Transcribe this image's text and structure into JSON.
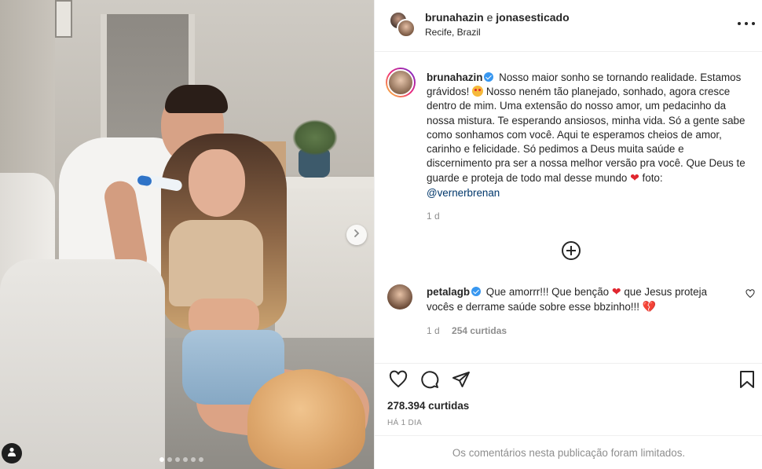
{
  "header": {
    "user1": "brunahazin",
    "conjunction": "e",
    "user2": "jonasesticado",
    "location": "Recife, Brazil"
  },
  "caption": {
    "username": "brunahazin",
    "text_part1": "Nosso maior sonho se tornando realidade. Estamos grávidos!",
    "text_part2": "Nosso neném tão planejado, sonhado, agora cresce dentro de mim. Uma extensão do nosso amor, um pedacinho da nossa mistura. Te esperando ansiosos, minha vida. Só a gente sabe como sonhamos com você. Aqui te esperamos cheios de amor, carinho e felicidade. Só pedimos a Deus muita saúde e discernimento pra ser a nossa melhor versão pra você. Que Deus te guarde e proteja de todo mal desse mundo",
    "text_part3": "foto:",
    "mention": "@vernerbrenan",
    "time": "1 d"
  },
  "comment": {
    "username": "petalagb",
    "text_part1": "Que amorrr!!! Que benção",
    "text_part2": "que Jesus proteja vocês e derrame saúde sobre esse bbzinho!!!",
    "time": "1 d",
    "likes": "254 curtidas"
  },
  "stats": {
    "likes": "278.394 curtidas",
    "time_ago": "HÁ 1 DIA"
  },
  "footer": {
    "notice": "Os comentários nesta publicação foram limitados."
  },
  "carousel": {
    "slide_count": 6,
    "active_index": 0
  },
  "icons": {
    "verified": "verified-badge-icon",
    "more": "more-options-icon",
    "add": "load-more-comments-icon",
    "like": "heart-icon",
    "comment": "comment-icon",
    "share": "share-icon",
    "save": "bookmark-icon",
    "next": "chevron-right-icon",
    "tag": "tagged-user-icon"
  },
  "colors": {
    "verified": "#3897f0",
    "heart": "#e0262f",
    "mention": "#00376b",
    "muted": "#8e8e8e"
  }
}
